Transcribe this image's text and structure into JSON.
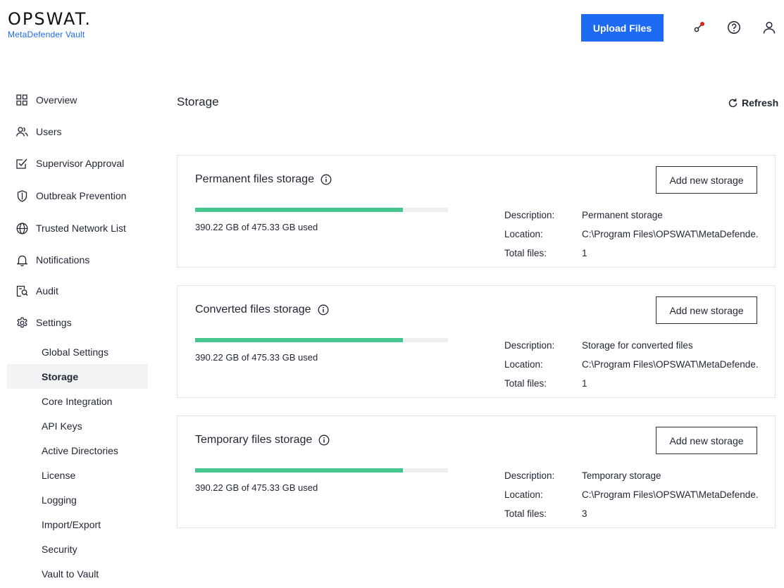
{
  "header": {
    "logo_main": "OPSWAT.",
    "logo_sub": "MetaDefender Vault",
    "upload_label": "Upload Files",
    "notification_dot_color": "#e0231b",
    "accent_color": "#1d6bf3"
  },
  "sidebar": {
    "items": [
      {
        "label": "Overview",
        "icon": "grid-icon"
      },
      {
        "label": "Users",
        "icon": "users-icon"
      },
      {
        "label": "Supervisor Approval",
        "icon": "checkbox-pen-icon"
      },
      {
        "label": "Outbreak Prevention",
        "icon": "shield-icon"
      },
      {
        "label": "Trusted Network List",
        "icon": "globe-icon"
      },
      {
        "label": "Notifications",
        "icon": "bell-icon"
      },
      {
        "label": "Audit",
        "icon": "audit-icon"
      },
      {
        "label": "Settings",
        "icon": "gear-icon"
      }
    ],
    "settings_sub": [
      {
        "label": "Global Settings"
      },
      {
        "label": "Storage",
        "active": true
      },
      {
        "label": "Core Integration"
      },
      {
        "label": "API Keys"
      },
      {
        "label": "Active Directories"
      },
      {
        "label": "License"
      },
      {
        "label": "Logging"
      },
      {
        "label": "Import/Export"
      },
      {
        "label": "Security"
      },
      {
        "label": "Vault to Vault"
      }
    ]
  },
  "main": {
    "title": "Storage",
    "refresh_label": "Refresh",
    "storages": [
      {
        "title": "Permanent files storage",
        "used_text": "390.22 GB of 475.33 GB used",
        "used_fraction": 0.821,
        "add_label": "Add new storage",
        "description_key": "Description:",
        "description": "Permanent storage",
        "location_key": "Location:",
        "location": "C:\\Program Files\\OPSWAT\\MetaDefende...",
        "total_key": "Total files:",
        "total_files": "1"
      },
      {
        "title": "Converted files storage",
        "used_text": "390.22 GB of 475.33 GB used",
        "used_fraction": 0.821,
        "add_label": "Add new storage",
        "description_key": "Description:",
        "description": "Storage for converted files",
        "location_key": "Location:",
        "location": "C:\\Program Files\\OPSWAT\\MetaDefende...",
        "total_key": "Total files:",
        "total_files": "1"
      },
      {
        "title": "Temporary files storage",
        "used_text": "390.22 GB of 475.33 GB used",
        "used_fraction": 0.821,
        "add_label": "Add new storage",
        "description_key": "Description:",
        "description": "Temporary storage",
        "location_key": "Location:",
        "location": "C:\\Program Files\\OPSWAT\\MetaDefende...",
        "total_key": "Total files:",
        "total_files": "3"
      }
    ],
    "bar_color": "#45c68d"
  }
}
